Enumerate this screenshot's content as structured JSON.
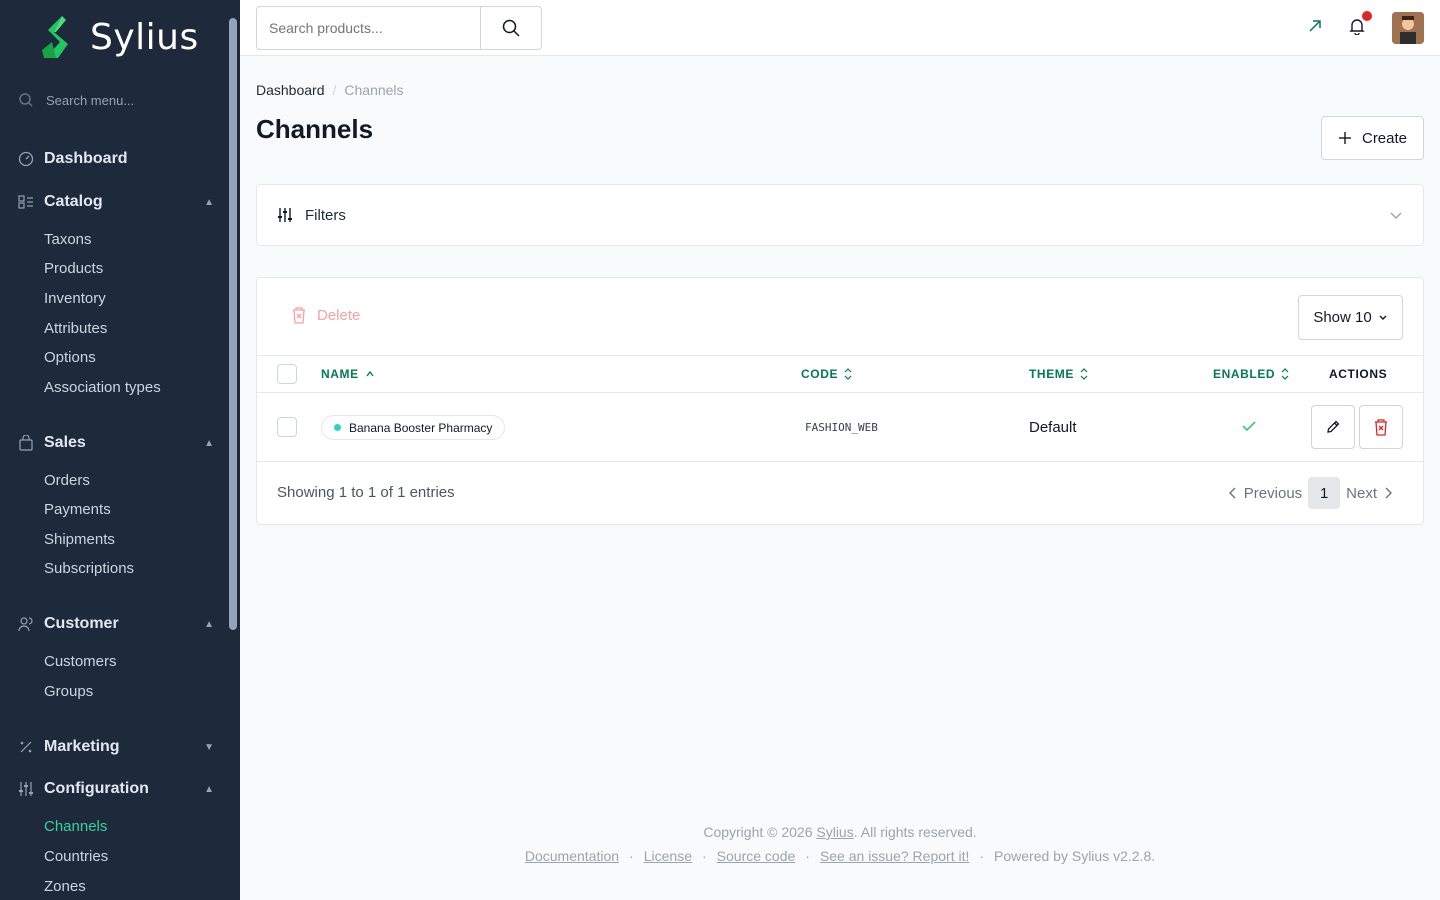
{
  "brand": {
    "name": "Sylius"
  },
  "sidebar": {
    "search_placeholder": "Search menu...",
    "dashboard": "Dashboard",
    "sections": [
      {
        "label": "Catalog",
        "items": [
          "Taxons",
          "Products",
          "Inventory",
          "Attributes",
          "Options",
          "Association types"
        ]
      },
      {
        "label": "Sales",
        "items": [
          "Orders",
          "Payments",
          "Shipments",
          "Subscriptions"
        ]
      },
      {
        "label": "Customer",
        "items": [
          "Customers",
          "Groups"
        ]
      },
      {
        "label": "Marketing",
        "items": []
      },
      {
        "label": "Configuration",
        "items": [
          "Channels",
          "Countries",
          "Zones"
        ]
      }
    ],
    "active_item": "Channels"
  },
  "topbar": {
    "search_placeholder": "Search products..."
  },
  "breadcrumb": {
    "home": "Dashboard",
    "separator": "/",
    "current": "Channels"
  },
  "page": {
    "title": "Channels",
    "create_label": "Create"
  },
  "filters": {
    "label": "Filters"
  },
  "grid": {
    "delete_label": "Delete",
    "show_label": "Show 10",
    "columns": {
      "name": "NAME",
      "code": "CODE",
      "theme": "THEME",
      "enabled": "ENABLED",
      "actions": "ACTIONS"
    },
    "rows": [
      {
        "name": "Banana Booster Pharmacy",
        "code": "FASHION_WEB",
        "theme": "Default",
        "enabled": true
      }
    ],
    "showing": "Showing 1 to 1 of 1 entries",
    "pagination": {
      "previous": "Previous",
      "page": "1",
      "next": "Next"
    }
  },
  "footer": {
    "copyright_prefix": "Copyright © 2026 ",
    "copyright_link": "Sylius",
    "copyright_suffix": ". All rights reserved.",
    "links": [
      "Documentation",
      "License",
      "Source code",
      "See an issue? Report it!"
    ],
    "powered": "Powered by Sylius v2.2.8."
  },
  "colors": {
    "sidebar_bg": "#1e293b",
    "accent": "#047857",
    "active_nav": "#34d399",
    "danger": "#dc2626"
  }
}
